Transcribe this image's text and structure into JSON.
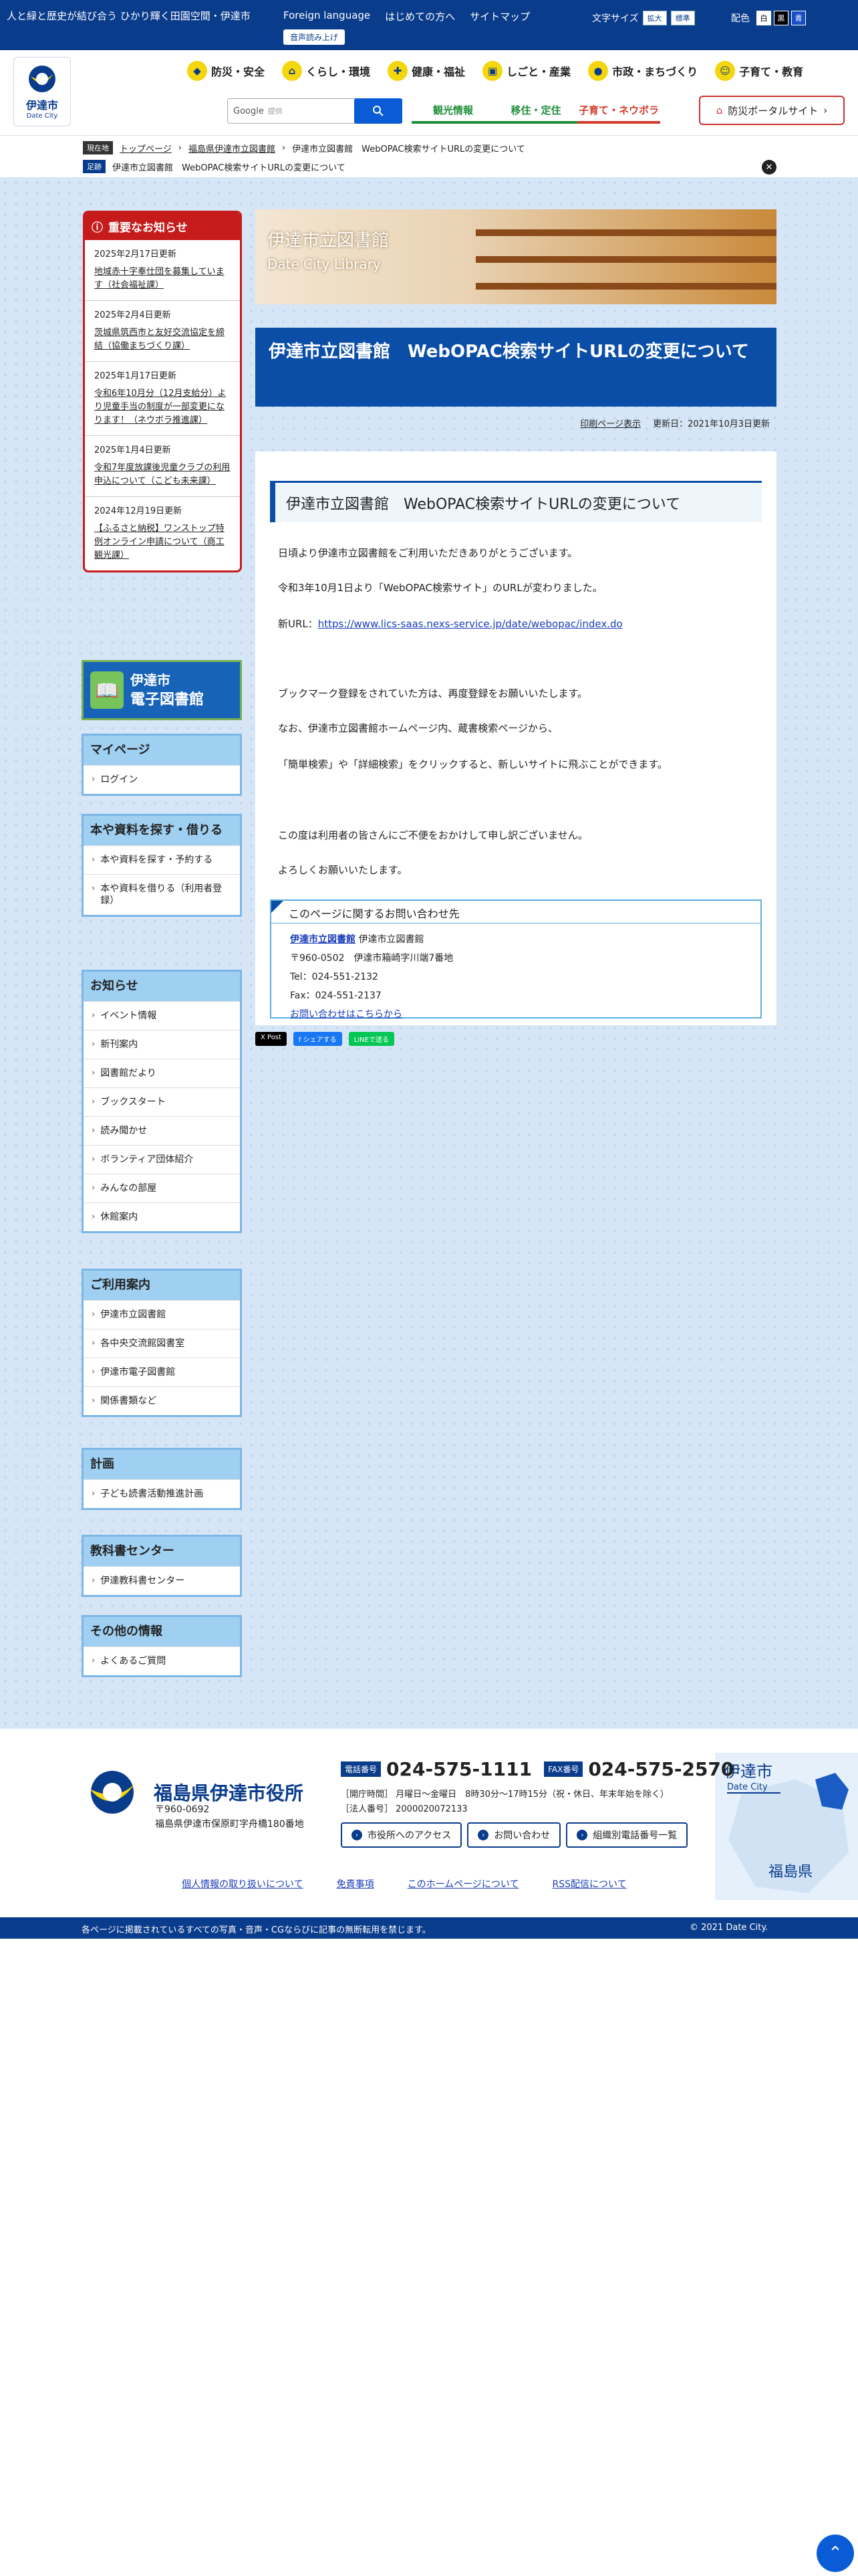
{
  "topbar": {
    "tagline": "人と緑と歴史が結び合う ひかり輝く田園空間・伊達市",
    "links": [
      "Foreign language",
      "はじめての方へ",
      "サイトマップ"
    ],
    "read_aloud": "音声読み上げ",
    "text_size_label": "文字サイズ",
    "text_size_options": [
      "拡大",
      "標準"
    ],
    "color_label": "配色",
    "color_options": [
      "白",
      "黒",
      "青"
    ]
  },
  "header": {
    "logo_text": "伊達市",
    "logo_sub": "Date City",
    "global_nav": [
      {
        "label": "防災・安全",
        "icon": "shield-icon"
      },
      {
        "label": "くらし・環境",
        "icon": "house-icon"
      },
      {
        "label": "健康・福祉",
        "icon": "cross-icon"
      },
      {
        "label": "しごと・産業",
        "icon": "briefcase-icon"
      },
      {
        "label": "市政・まちづくり",
        "icon": "city-icon"
      },
      {
        "label": "子育て・教育",
        "icon": "child-icon"
      }
    ],
    "search_label": "Google",
    "search_placeholder": "提供",
    "sub_nav": [
      {
        "label": "観光情報",
        "color": "#1f8e3a"
      },
      {
        "label": "移住・定住",
        "color": "#1f8e3a"
      },
      {
        "label": "子育て・ネウボラ",
        "color": "#d23b2c"
      }
    ],
    "portal_label": "防災ポータルサイト"
  },
  "breadcrumb": {
    "current_tag": "現在地",
    "items": [
      "トップページ",
      "福島県伊達市立図書館",
      "伊達市立図書館　WebOPAC検索サイトURLの変更について"
    ],
    "history_tag": "足跡",
    "history": "伊達市立図書館　WebOPAC検索サイトURLの変更について"
  },
  "notices": {
    "heading": "重要なお知らせ",
    "items": [
      {
        "date": "2025年2月17日更新",
        "text": "地域赤十字奉仕団を募集しています（社会福祉課）"
      },
      {
        "date": "2025年2月4日更新",
        "text": "茨城県筑西市と友好交流協定を締結（協働まちづくり課）"
      },
      {
        "date": "2025年1月17日更新",
        "text": "令和6年10月分（12月支給分）より児童手当の制度が一部変更になります！（ネウボラ推進課）"
      },
      {
        "date": "2025年1月4日更新",
        "text": "令和7年度放課後児童クラブの利用申込について（こども未来課）"
      },
      {
        "date": "2024年12月19日更新",
        "text": "【ふるさと納税】ワンストップ特例オンライン申請について（商工観光課）"
      }
    ]
  },
  "ebook": {
    "line1": "伊達市",
    "line2": "電子図書館"
  },
  "side_blocks": [
    {
      "title": "マイページ",
      "items": [
        "ログイン"
      ]
    },
    {
      "title": "本や資料を探す・借りる",
      "items": [
        "本や資料を探す・予約する",
        "本や資料を借りる（利用者登録）"
      ]
    },
    {
      "title": "お知らせ",
      "items": [
        "イベント情報",
        "新刊案内",
        "図書館だより",
        "ブックスタート",
        "読み聞かせ",
        "ボランティア団体紹介",
        "みんなの部屋",
        "休館案内"
      ]
    },
    {
      "title": "ご利用案内",
      "items": [
        "伊達市立図書館",
        "各中央交流館図書室",
        "伊達市電子図書館",
        "関係書類など"
      ]
    },
    {
      "title": "計画",
      "items": [
        "子ども読書活動推進計画"
      ]
    },
    {
      "title": "教科書センター",
      "items": [
        "伊達教科書センター"
      ]
    },
    {
      "title": "その他の情報",
      "items": [
        "よくあるご質問"
      ]
    }
  ],
  "banner": {
    "title": "伊達市立図書館",
    "subtitle": "Date City Library"
  },
  "page": {
    "title": "伊達市立図書館　WebOPAC検索サイトURLの変更について",
    "print_link": "印刷ページ表示",
    "updated": "更新日：2021年10月3日更新",
    "heading": "伊達市立図書館　WebOPAC検索サイトURLの変更について",
    "p1": "日頃より伊達市立図書館をご利用いただきありがとうございます。",
    "p2": "令和3年10月1日より「WebOPAC検索サイト」のURLが変わりました。",
    "p3_label": "新URL：",
    "p3_link": "https://www.lics-saas.nexs-service.jp/date/webopac/index.do",
    "p4": "ブックマーク登録をされていた方は、再度登録をお願いいたします。",
    "p5": "なお、伊達市立図書館ホームページ内、蔵書検索ページから、",
    "p6": "「簡単検索」や「詳細検索」をクリックすると、新しいサイトに飛ぶことができます。",
    "p7": "この度は利用者の皆さんにご不便をおかけして申し訳ございません。",
    "p8": "よろしくお願いいたします。"
  },
  "contact": {
    "heading": "このページに関するお問い合わせ先",
    "dept_link": "伊達市立図書館",
    "dept_name": "伊達市立図書館",
    "address": "〒960-0502　伊達市箱崎字川端7番地",
    "tel": "Tel：024-551-2132",
    "fax": "Fax：024-551-2137",
    "form_link": "お問い合わせはこちらから"
  },
  "social": [
    "X Post",
    "f シェアする",
    "LINEで送る"
  ],
  "footer": {
    "name": "福島県伊達市役所",
    "postal": "〒960-0692",
    "address": "福島県伊達市保原町字舟橋180番地",
    "tel_tag": "電話番号",
    "tel": "024-575-1111",
    "fax_tag": "FAX番号",
    "fax": "024-575-2570",
    "hours": "［開庁時間］ 月曜日～金曜日　8時30分～17時15分（祝・休日、年末年始を除く）",
    "corp_no": "［法人番号］ 2000020072133",
    "buttons": [
      "市役所へのアクセス",
      "お問い合わせ",
      "組織別電話番号一覧"
    ],
    "city_mark": "伊達市",
    "city_mark_sub": "Date City",
    "prefecture": "福島県",
    "links": [
      "個人情報の取り扱いについて",
      "免責事項",
      "このホームページについて",
      "RSS配信について"
    ],
    "copyright_notice": "各ページに掲載されているすべての写真・音声・CGならびに記事の無断転用を禁じます。",
    "copyright": "© 2021 Date City."
  }
}
